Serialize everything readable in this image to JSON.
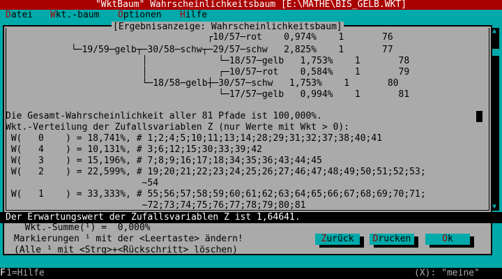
{
  "title_bar": {
    "text": "\"WktBaum\" Wahrscheinlichkeitsbaum [E:\\MATHE\\BIS_GELB.WKT]"
  },
  "menu": {
    "items": [
      {
        "hot": "D",
        "rest": "atei"
      },
      {
        "hot": "W",
        "rest": "kt.-baum"
      },
      {
        "hot": "O",
        "rest": "ptionen"
      },
      {
        "hot": "H",
        "rest": "ilfe"
      }
    ]
  },
  "window": {
    "title": "[Ergebnisanzeige: Wahrscheinlichkeitsbaum]",
    "lines": [
      "                                     ┌10/57─rot    0,974%    1       76",
      "            └─19/59─gelb┬─30/58─schw┬─29/57─schw   2,825%    1       77",
      "                         │             └─18/57─gelb   1,753%    1       78",
      "                         │             ┌─10/57─rot    0,584%    1       79",
      "                         └─18/58─gelb┼─30/57─schw   1,753%    1       80",
      "                                       └─17/57─gelb   0,994%    1       81",
      "",
      "Die Gesamt-Wahrscheinlichkeit aller 81 Pfade ist 100,000%.",
      "Wkt.-Verteilung der Zufallsvariablen Z (nur Werte mit Wkt > 0):",
      " W(   0    ) = 18,741%, # 1;2;4;5;10;11;13;14;28;29;31;32;37;38;40;41",
      " W(   4    ) = 10,131%, # 3;6;12;15;30;33;39;42",
      " W(   3    ) = 15,196%, # 7;8;9;16;17;18;34;35;36;43;44;45",
      " W(   2    ) = 22,599%, # 19;20;21;22;23;24;25;26;27;46;47;48;49;50;51;52;53;",
      "                         ~54",
      "",
      " W(   1    ) = 33,333%, # 55;56;57;58;59;60;61;62;63;64;65;66;67;68;69;70;71;",
      "                         ~72;73;74;75;76;77;78;79;80;81"
    ],
    "expectation": "Der Erwartungswert der Zufallsvariablen Z ist 1,64641.",
    "sum_line": "  Wkt.-Summe(¹) =  0,000%",
    "hint1": "Markierungen ¹ mit der <Leertaste> ändern!",
    "hint2": "(Alle ¹ mit <Strg>+<Rückschritt> löschen)"
  },
  "buttons": {
    "back": {
      "pre": "",
      "hot": "Z",
      "rest": "urück"
    },
    "print": {
      "pre": "",
      "hot": "D",
      "rest": "rucken"
    },
    "ok": {
      "pre": " ",
      "hot": "O",
      "rest": "k"
    }
  },
  "status": {
    "key": "F",
    "left": "1=Hilfe",
    "right": "(X): \"meine\""
  },
  "colors": {
    "title_bg": "#aa0000",
    "menu_bg": "#00aaaa",
    "window_bg": "#aaaaaa",
    "status_bg": "#000000"
  },
  "icons": {
    "scroll_up": "triangle-up-icon",
    "scroll_down": "triangle-down-icon",
    "cursor": "block-cursor-icon"
  }
}
